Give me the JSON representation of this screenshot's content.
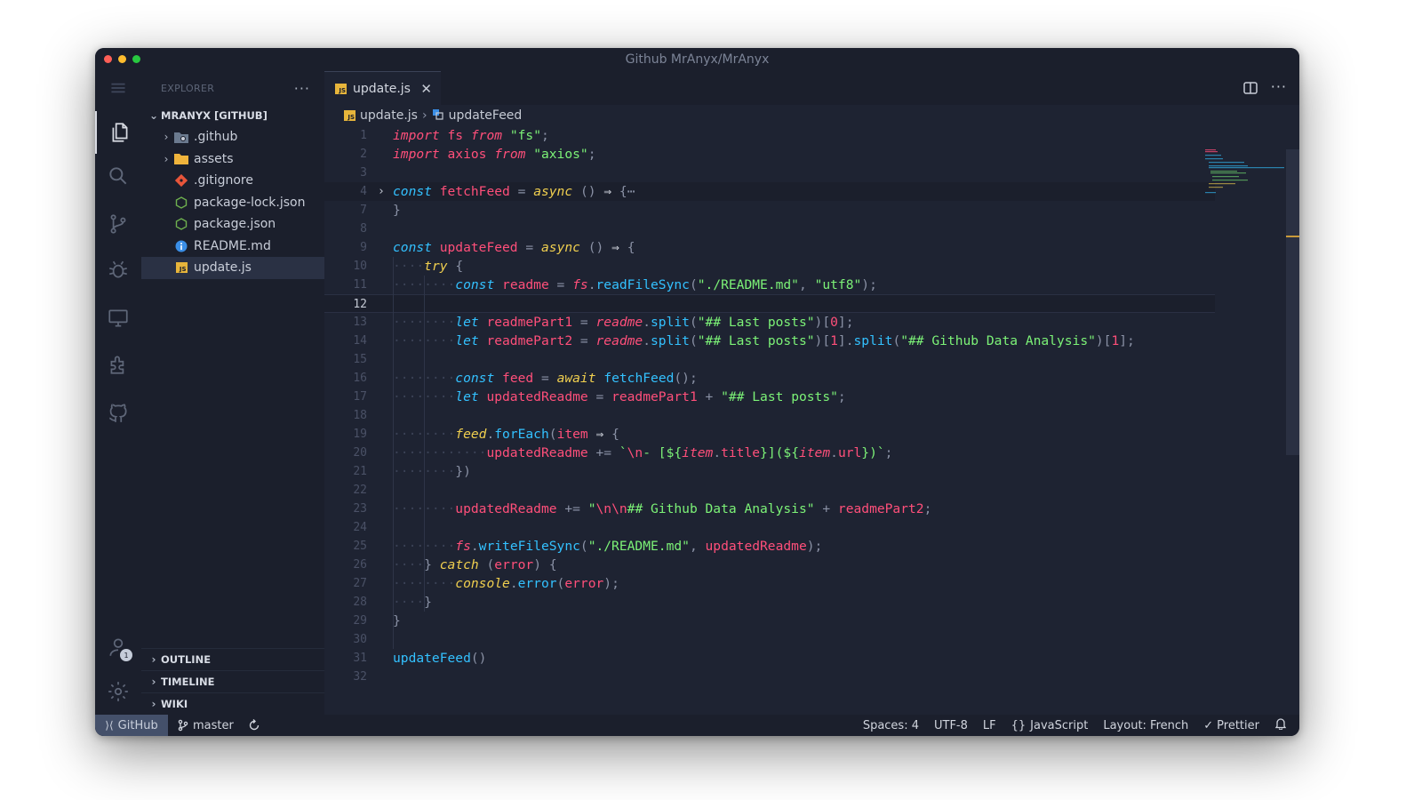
{
  "window": {
    "title": "Github MrAnyx/MrAnyx"
  },
  "explorer": {
    "header": "EXPLORER",
    "more": "···",
    "root": "MRANYX [GITHUB]",
    "items": [
      {
        "label": ".github",
        "type": "folder"
      },
      {
        "label": "assets",
        "type": "folder"
      },
      {
        "label": ".gitignore",
        "type": "git"
      },
      {
        "label": "package-lock.json",
        "type": "json"
      },
      {
        "label": "package.json",
        "type": "json"
      },
      {
        "label": "README.md",
        "type": "info"
      },
      {
        "label": "update.js",
        "type": "js",
        "selected": true
      }
    ],
    "sections": [
      "OUTLINE",
      "TIMELINE",
      "WIKI"
    ]
  },
  "tab": {
    "label": "update.js",
    "close": "✕",
    "icon": "JS"
  },
  "breadcrumb": {
    "file": "update.js",
    "separator": "›",
    "symbol": "updateFeed"
  },
  "status": {
    "remote": "GitHub",
    "branch": "master",
    "spaces": "Spaces: 4",
    "encoding": "UTF-8",
    "eol": "LF",
    "language": "JavaScript",
    "layout": "Layout: French",
    "prettier": "Prettier"
  },
  "activity_badge": "1",
  "code": {
    "lines": [
      {
        "n": "1",
        "tokens": [
          [
            "imp",
            "import"
          ],
          [
            "white",
            " "
          ],
          [
            "var",
            "fs"
          ],
          [
            "white",
            " "
          ],
          [
            "imp",
            "from"
          ],
          [
            "white",
            " "
          ],
          [
            "str",
            "\"fs\""
          ],
          [
            "punc",
            ";"
          ]
        ]
      },
      {
        "n": "2",
        "tokens": [
          [
            "imp",
            "import"
          ],
          [
            "white",
            " "
          ],
          [
            "var",
            "axios"
          ],
          [
            "white",
            " "
          ],
          [
            "imp",
            "from"
          ],
          [
            "white",
            " "
          ],
          [
            "str",
            "\"axios\""
          ],
          [
            "punc",
            ";"
          ]
        ]
      },
      {
        "n": "3",
        "tokens": []
      },
      {
        "n": "4",
        "fold": true,
        "tokens": [
          [
            "kw",
            "const"
          ],
          [
            "white",
            " "
          ],
          [
            "var",
            "fetchFeed"
          ],
          [
            "white",
            " "
          ],
          [
            "op",
            "="
          ],
          [
            "white",
            " "
          ],
          [
            "kw2",
            "async"
          ],
          [
            "white",
            " "
          ],
          [
            "punc",
            "()"
          ],
          [
            "white",
            " "
          ],
          [
            "white",
            "⇒"
          ],
          [
            "white",
            " "
          ],
          [
            "punc",
            "{"
          ],
          [
            "punc",
            "⋯"
          ]
        ]
      },
      {
        "n": "7",
        "tokens": [
          [
            "punc",
            "}"
          ]
        ]
      },
      {
        "n": "8",
        "tokens": []
      },
      {
        "n": "9",
        "tokens": [
          [
            "kw",
            "const"
          ],
          [
            "white",
            " "
          ],
          [
            "var",
            "updateFeed"
          ],
          [
            "white",
            " "
          ],
          [
            "op",
            "="
          ],
          [
            "white",
            " "
          ],
          [
            "kw2",
            "async"
          ],
          [
            "white",
            " "
          ],
          [
            "punc",
            "()"
          ],
          [
            "white",
            " "
          ],
          [
            "white",
            "⇒"
          ],
          [
            "white",
            " "
          ],
          [
            "punc",
            "{"
          ]
        ]
      },
      {
        "n": "10",
        "indent": 1,
        "tokens": [
          [
            "kw2",
            "try"
          ],
          [
            "white",
            " "
          ],
          [
            "punc",
            "{"
          ]
        ]
      },
      {
        "n": "11",
        "indent": 2,
        "tokens": [
          [
            "kw",
            "const"
          ],
          [
            "white",
            " "
          ],
          [
            "var",
            "readme"
          ],
          [
            "white",
            " "
          ],
          [
            "op",
            "="
          ],
          [
            "white",
            " "
          ],
          [
            "fsvar",
            "fs"
          ],
          [
            "punc",
            "."
          ],
          [
            "fn",
            "readFileSync"
          ],
          [
            "punc",
            "("
          ],
          [
            "str",
            "\"./README.md\""
          ],
          [
            "punc",
            ", "
          ],
          [
            "str",
            "\"utf8\""
          ],
          [
            "punc",
            ");"
          ]
        ]
      },
      {
        "n": "12",
        "current": true,
        "tokens": []
      },
      {
        "n": "13",
        "indent": 2,
        "tokens": [
          [
            "kw",
            "let"
          ],
          [
            "white",
            " "
          ],
          [
            "var",
            "readmePart1"
          ],
          [
            "white",
            " "
          ],
          [
            "op",
            "="
          ],
          [
            "white",
            " "
          ],
          [
            "obj",
            "readme"
          ],
          [
            "punc",
            "."
          ],
          [
            "fn",
            "split"
          ],
          [
            "punc",
            "("
          ],
          [
            "str",
            "\"## Last posts\""
          ],
          [
            "punc",
            ")["
          ],
          [
            "num",
            "0"
          ],
          [
            "punc",
            "];"
          ]
        ]
      },
      {
        "n": "14",
        "indent": 2,
        "tokens": [
          [
            "kw",
            "let"
          ],
          [
            "white",
            " "
          ],
          [
            "var",
            "readmePart2"
          ],
          [
            "white",
            " "
          ],
          [
            "op",
            "="
          ],
          [
            "white",
            " "
          ],
          [
            "obj",
            "readme"
          ],
          [
            "punc",
            "."
          ],
          [
            "fn",
            "split"
          ],
          [
            "punc",
            "("
          ],
          [
            "str",
            "\"## Last posts\""
          ],
          [
            "punc",
            ")["
          ],
          [
            "num",
            "1"
          ],
          [
            "punc",
            "]."
          ],
          [
            "fn",
            "split"
          ],
          [
            "punc",
            "("
          ],
          [
            "str",
            "\"## Github Data Analysis\""
          ],
          [
            "punc",
            ")["
          ],
          [
            "num",
            "1"
          ],
          [
            "punc",
            "];"
          ]
        ]
      },
      {
        "n": "15",
        "tokens": []
      },
      {
        "n": "16",
        "indent": 2,
        "tokens": [
          [
            "kw",
            "const"
          ],
          [
            "white",
            " "
          ],
          [
            "var",
            "feed"
          ],
          [
            "white",
            " "
          ],
          [
            "op",
            "="
          ],
          [
            "white",
            " "
          ],
          [
            "kw2",
            "await"
          ],
          [
            "white",
            " "
          ],
          [
            "fn",
            "fetchFeed"
          ],
          [
            "punc",
            "();"
          ]
        ]
      },
      {
        "n": "17",
        "indent": 2,
        "tokens": [
          [
            "kw",
            "let"
          ],
          [
            "white",
            " "
          ],
          [
            "var",
            "updatedReadme"
          ],
          [
            "white",
            " "
          ],
          [
            "op",
            "="
          ],
          [
            "white",
            " "
          ],
          [
            "var",
            "readmePart1"
          ],
          [
            "white",
            " "
          ],
          [
            "op",
            "+"
          ],
          [
            "white",
            " "
          ],
          [
            "str",
            "\"## Last posts\""
          ],
          [
            "punc",
            ";"
          ]
        ]
      },
      {
        "n": "18",
        "tokens": []
      },
      {
        "n": "19",
        "indent": 2,
        "tokens": [
          [
            "kw2",
            "feed"
          ],
          [
            "punc",
            "."
          ],
          [
            "fn",
            "forEach"
          ],
          [
            "punc",
            "("
          ],
          [
            "var",
            "item"
          ],
          [
            "white",
            " "
          ],
          [
            "white",
            "⇒"
          ],
          [
            "white",
            " "
          ],
          [
            "punc",
            "{"
          ]
        ]
      },
      {
        "n": "20",
        "indent": 3,
        "tokens": [
          [
            "var",
            "updatedReadme"
          ],
          [
            "white",
            " "
          ],
          [
            "op",
            "+="
          ],
          [
            "white",
            " "
          ],
          [
            "str",
            "`"
          ],
          [
            "esc",
            "\\n"
          ],
          [
            "str",
            "- [${"
          ],
          [
            "obj",
            "item"
          ],
          [
            "punc",
            "."
          ],
          [
            "var",
            "title"
          ],
          [
            "str",
            "}](${"
          ],
          [
            "obj",
            "item"
          ],
          [
            "punc",
            "."
          ],
          [
            "var",
            "url"
          ],
          [
            "str",
            "})`"
          ],
          [
            "punc",
            ";"
          ]
        ]
      },
      {
        "n": "21",
        "indent": 2,
        "tokens": [
          [
            "punc",
            "})"
          ]
        ]
      },
      {
        "n": "22",
        "tokens": []
      },
      {
        "n": "23",
        "indent": 2,
        "tokens": [
          [
            "var",
            "updatedReadme"
          ],
          [
            "white",
            " "
          ],
          [
            "op",
            "+="
          ],
          [
            "white",
            " "
          ],
          [
            "str",
            "\""
          ],
          [
            "esc",
            "\\n\\n"
          ],
          [
            "str",
            "## Github Data Analysis\""
          ],
          [
            "white",
            " "
          ],
          [
            "op",
            "+"
          ],
          [
            "white",
            " "
          ],
          [
            "var",
            "readmePart2"
          ],
          [
            "punc",
            ";"
          ]
        ]
      },
      {
        "n": "24",
        "tokens": []
      },
      {
        "n": "25",
        "indent": 2,
        "tokens": [
          [
            "fsvar",
            "fs"
          ],
          [
            "punc",
            "."
          ],
          [
            "fn",
            "writeFileSync"
          ],
          [
            "punc",
            "("
          ],
          [
            "str",
            "\"./README.md\""
          ],
          [
            "punc",
            ", "
          ],
          [
            "var",
            "updatedReadme"
          ],
          [
            "punc",
            ");"
          ]
        ]
      },
      {
        "n": "26",
        "indent": 1,
        "tokens": [
          [
            "punc",
            "}"
          ],
          [
            "white",
            " "
          ],
          [
            "kw2",
            "catch"
          ],
          [
            "white",
            " "
          ],
          [
            "punc",
            "("
          ],
          [
            "var",
            "error"
          ],
          [
            "punc",
            ")"
          ],
          [
            "white",
            " "
          ],
          [
            "punc",
            "{"
          ]
        ]
      },
      {
        "n": "27",
        "indent": 2,
        "tokens": [
          [
            "kw2",
            "console"
          ],
          [
            "punc",
            "."
          ],
          [
            "fn",
            "error"
          ],
          [
            "punc",
            "("
          ],
          [
            "var",
            "error"
          ],
          [
            "punc",
            ");"
          ]
        ]
      },
      {
        "n": "28",
        "indent": 1,
        "tokens": [
          [
            "punc",
            "}"
          ]
        ]
      },
      {
        "n": "29",
        "tokens": [
          [
            "punc",
            "}"
          ]
        ]
      },
      {
        "n": "30",
        "tokens": []
      },
      {
        "n": "31",
        "tokens": [
          [
            "fn",
            "updateFeed"
          ],
          [
            "punc",
            "()"
          ]
        ]
      },
      {
        "n": "32",
        "tokens": []
      }
    ]
  }
}
